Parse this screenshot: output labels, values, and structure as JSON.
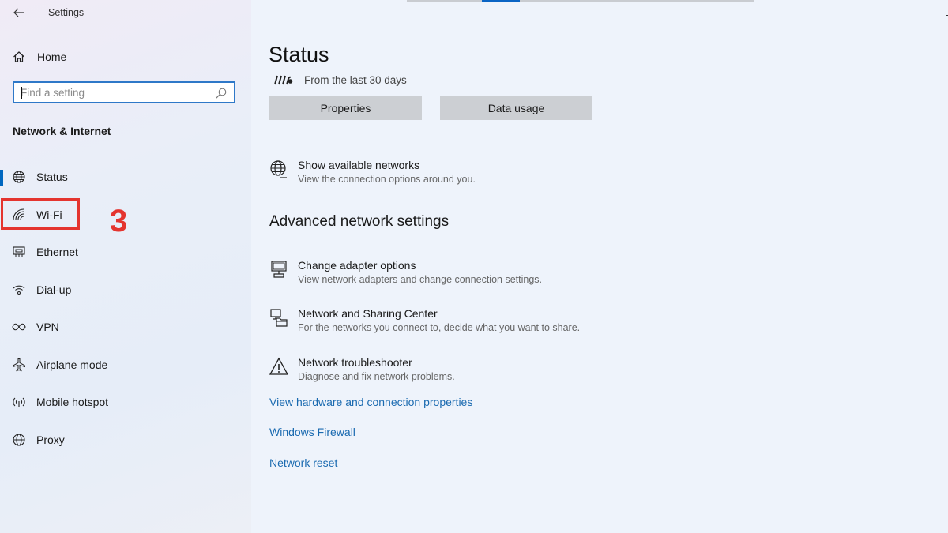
{
  "app": {
    "title": "Settings"
  },
  "sidebar": {
    "home_label": "Home",
    "search_placeholder": "Find a setting",
    "section_title": "Network & Internet",
    "items": [
      {
        "label": "Status",
        "icon": "globe-icon",
        "selected": true
      },
      {
        "label": "Wi-Fi",
        "icon": "wifi-icon",
        "selected": false
      },
      {
        "label": "Ethernet",
        "icon": "ethernet-icon",
        "selected": false
      },
      {
        "label": "Dial-up",
        "icon": "dialup-icon",
        "selected": false
      },
      {
        "label": "VPN",
        "icon": "vpn-icon",
        "selected": false
      },
      {
        "label": "Airplane mode",
        "icon": "airplane-icon",
        "selected": false
      },
      {
        "label": "Mobile hotspot",
        "icon": "hotspot-icon",
        "selected": false
      },
      {
        "label": "Proxy",
        "icon": "globe-icon",
        "selected": false
      }
    ]
  },
  "annotation": {
    "step_number": "3",
    "color": "#e4342f"
  },
  "main": {
    "page_title": "Status",
    "usage_text": "From the last 30 days",
    "buttons": {
      "properties": "Properties",
      "data_usage": "Data usage"
    },
    "show_networks": {
      "title": "Show available networks",
      "desc": "View the connection options around you."
    },
    "advanced_heading": "Advanced network settings",
    "advanced_items": [
      {
        "title": "Change adapter options",
        "desc": "View network adapters and change connection settings.",
        "icon": "adapter-icon"
      },
      {
        "title": "Network and Sharing Center",
        "desc": "For the networks you connect to, decide what you want to share.",
        "icon": "sharing-center-icon"
      },
      {
        "title": "Network troubleshooter",
        "desc": "Diagnose and fix network problems.",
        "icon": "warning-icon"
      }
    ],
    "links": [
      "View hardware and connection properties",
      "Windows Firewall",
      "Network reset"
    ]
  },
  "colors": {
    "accent": "#0067c0",
    "link": "#1a6ab0",
    "highlight": "#e4342f"
  }
}
